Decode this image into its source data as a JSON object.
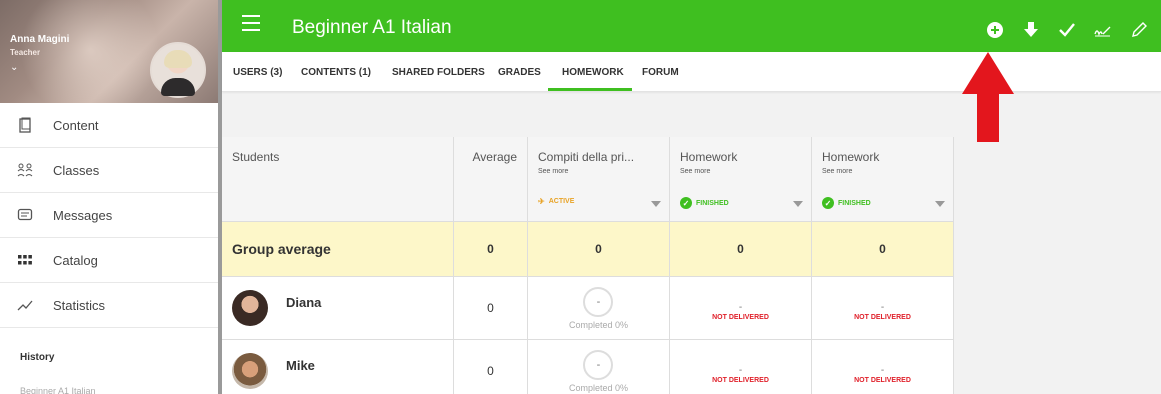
{
  "profile": {
    "name": "Anna Magini",
    "role": "Teacher",
    "chevron": "⌄"
  },
  "sidebar": {
    "items": [
      {
        "label": "Content",
        "icon": "content-icon"
      },
      {
        "label": "Classes",
        "icon": "classes-icon"
      },
      {
        "label": "Messages",
        "icon": "messages-icon"
      },
      {
        "label": "Catalog",
        "icon": "catalog-icon"
      },
      {
        "label": "Statistics",
        "icon": "statistics-icon"
      }
    ],
    "history_label": "History",
    "history_sub": "Beginner A1 Italian"
  },
  "header": {
    "title": "Beginner A1 Italian",
    "icons": [
      "add-icon",
      "download-icon",
      "check-icon",
      "signature-icon",
      "edit-icon"
    ],
    "accent": "#3fbf20"
  },
  "tabs": [
    {
      "label": "USERS (3)"
    },
    {
      "label": "CONTENTS (1)"
    },
    {
      "label": "SHARED FOLDERS"
    },
    {
      "label": "GRADES"
    },
    {
      "label": "HOMEWORK",
      "active": true
    },
    {
      "label": "FORUM"
    }
  ],
  "table": {
    "students_header": "Students",
    "average_header": "Average",
    "homework": [
      {
        "title": "Compiti della pri...",
        "see_more": "See more",
        "status": "ACTIVE",
        "status_color": "#e8a326"
      },
      {
        "title": "Homework",
        "see_more": "See more",
        "status": "FINISHED",
        "status_color": "#3fbf20"
      },
      {
        "title": "Homework",
        "see_more": "See more",
        "status": "FINISHED",
        "status_color": "#3fbf20"
      }
    ],
    "group_average": {
      "label": "Group average",
      "average": "0",
      "values": [
        "0",
        "0",
        "0"
      ]
    },
    "students": [
      {
        "name": "Diana",
        "average": "0",
        "ring": "-",
        "completed": "Completed 0%",
        "hw2_dash": "-",
        "hw2": "NOT DELIVERED",
        "hw3_dash": "-",
        "hw3": "NOT DELIVERED"
      },
      {
        "name": "Mike",
        "average": "0",
        "ring": "-",
        "completed": "Completed 0%",
        "hw2_dash": "-",
        "hw2": "NOT DELIVERED",
        "hw3_dash": "-",
        "hw3": "NOT DELIVERED"
      }
    ]
  },
  "status_colors": {
    "not_delivered": "#e0202a",
    "pointer_arrow": "#e3161d"
  }
}
